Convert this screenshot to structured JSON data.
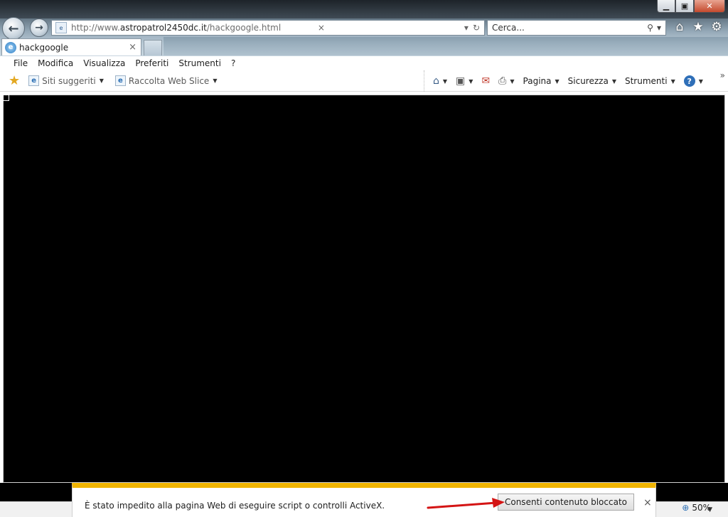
{
  "window": {
    "min_glyph": "▁",
    "max_glyph": "▣",
    "close_glyph": "✕"
  },
  "nav": {
    "back_glyph": "←",
    "forward_glyph": "→"
  },
  "address_bar": {
    "url_prefix": "http://www.",
    "url_host": "astropatrol2450dc.it",
    "url_path": "/hackgoogle.html",
    "favicon": "e",
    "dropdown_glyph": "▾",
    "refresh_glyph": "↻",
    "stop_glyph": "×"
  },
  "search": {
    "placeholder": "Cerca...",
    "icon_glyph": "⚲",
    "dropdown_glyph": "▾"
  },
  "command_icons": {
    "home": "⌂",
    "favorites": "★",
    "tools": "⚙"
  },
  "tab": {
    "title": "hackgoogle",
    "icon": "e",
    "close": "×"
  },
  "menu": {
    "items": [
      "File",
      "Modifica",
      "Visualizza",
      "Preferiti",
      "Strumenti",
      "?"
    ]
  },
  "favorites_bar": {
    "star_glyph": "★",
    "items": [
      {
        "label": "Siti suggeriti",
        "icon": "e"
      },
      {
        "label": "Raccolta Web Slice",
        "icon": "e"
      }
    ]
  },
  "command_bar": {
    "home_glyph": "⌂",
    "feeds_glyph": "▣",
    "mail_glyph": "✉",
    "print_glyph": "⎙",
    "page_label": "Pagina",
    "safety_label": "Sicurezza",
    "tools_label": "Strumenti",
    "help_glyph": "?",
    "chevron": "»"
  },
  "content": {
    "broken_image_glyph": "⊠"
  },
  "notification": {
    "message": "È stato impedito alla pagina Web di eseguire script o controlli ActiveX.",
    "button_label": "Consenti contenuto bloccato",
    "close_glyph": "×",
    "accent_color": "#f0b400"
  },
  "status": {
    "zoom_label": "50%",
    "zoom_icon": "⊕"
  }
}
